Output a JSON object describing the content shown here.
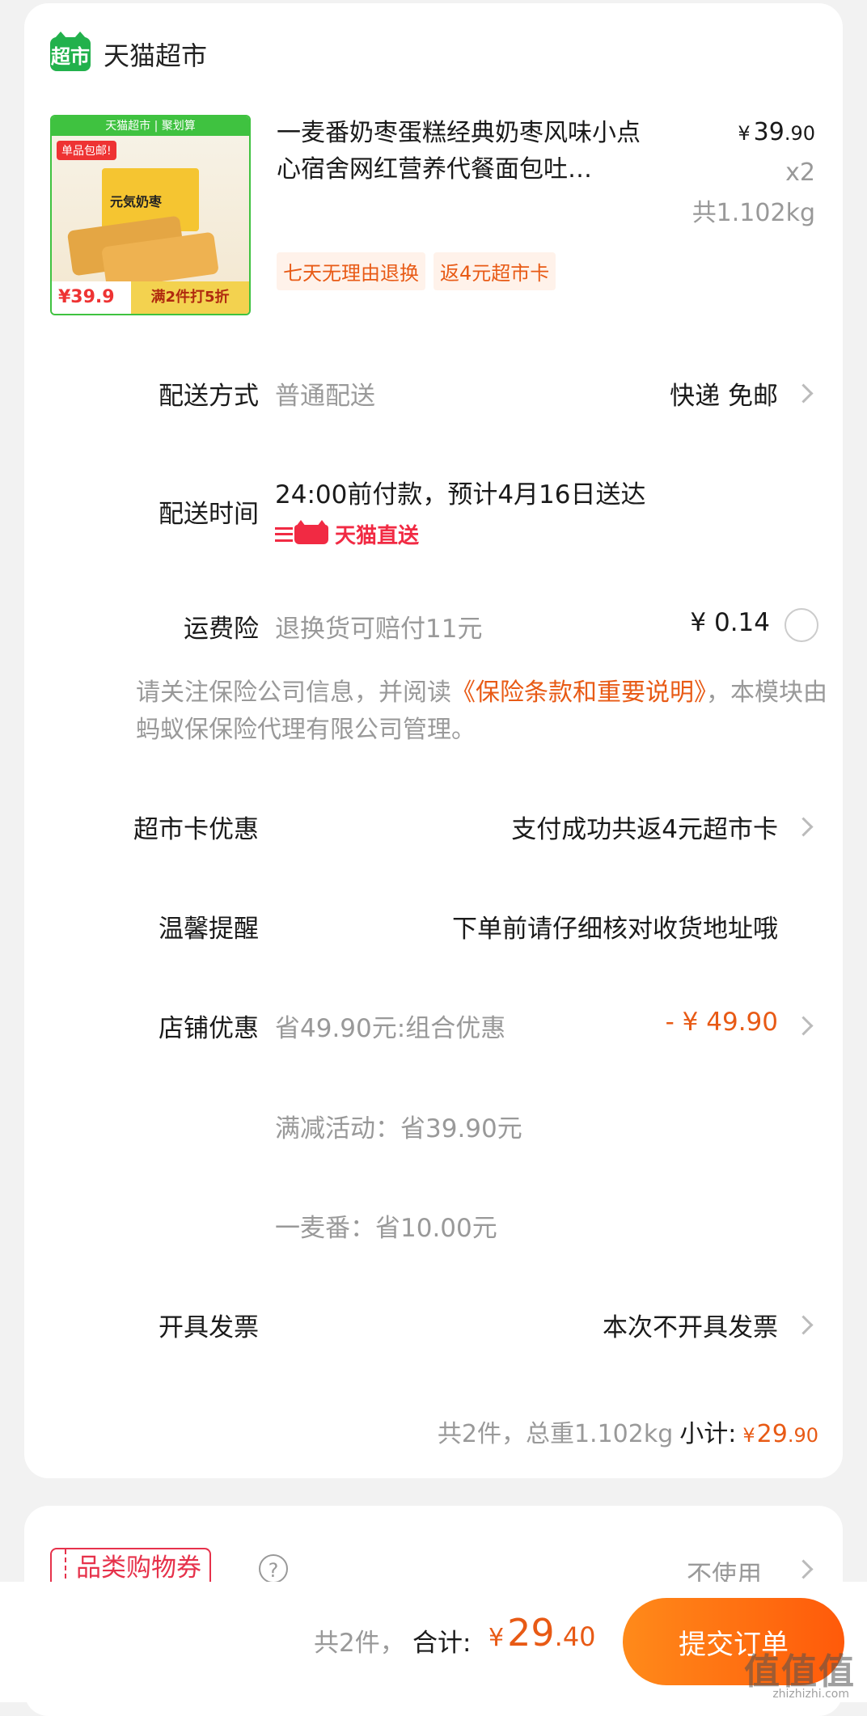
{
  "shop": {
    "logo_text": "超市",
    "name": "天猫超市"
  },
  "product": {
    "image": {
      "top_banner": "天猫超市 | 聚划算",
      "badge": "单品包邮!",
      "box_label": "元気奶枣",
      "price_tag": "¥39.9",
      "promo": "满2件打5折"
    },
    "title": "一麦番奶枣蛋糕经典奶枣风味小点心宿舍网红营养代餐面包吐…",
    "price_symbol": "¥",
    "price_int": "39",
    "price_dec": ".90",
    "quantity": "x2",
    "weight": "共1.102kg",
    "tags": [
      "七天无理由退换",
      "返4元超市卡"
    ]
  },
  "delivery": {
    "method_label": "配送方式",
    "method_value": "普通配送",
    "method_right": "快递 免邮",
    "time_label": "配送时间",
    "time_value": "24:00前付款，预计4月16日送达",
    "tmall_direct": "天猫直送"
  },
  "insurance": {
    "label": "运费险",
    "value": "退换货可赔付11元",
    "price": "¥ 0.14",
    "note_prefix": "请关注保险公司信息，并阅读",
    "note_link": "《保险条款和重要说明》",
    "note_suffix": "，本模块由蚂蚁保保险代理有限公司管理。"
  },
  "supermarket_card": {
    "label": "超市卡优惠",
    "value": "支付成功共返4元超市卡"
  },
  "reminder": {
    "label": "温馨提醒",
    "value": "下单前请仔细核对收货地址哦"
  },
  "store_discount": {
    "label": "店铺优惠",
    "value": "省49.90元:组合优惠",
    "amount": "- ¥ 49.90",
    "sub1": "满减活动：省39.90元",
    "sub2": "一麦番：省10.00元"
  },
  "invoice": {
    "label": "开具发票",
    "value": "本次不开具发票"
  },
  "summary": {
    "count_weight": "共2件，总重1.102kg",
    "subtotal_label": "小计:",
    "price_symbol": "¥",
    "price_int": "29",
    "price_dec": ".90"
  },
  "coupon": {
    "badge": "品类购物券",
    "help": "?",
    "value": "不使用"
  },
  "bottom_bar": {
    "count": "共2件，",
    "total_label": "合计:",
    "total_symbol": "¥",
    "total_int": "29",
    "total_dec": ".40",
    "submit": "提交订单"
  },
  "watermark": {
    "main": "值值值",
    "sub": "zhizhizhi.com"
  },
  "colors": {
    "accent": "#e85a15",
    "tmall_red": "#f12a43",
    "green": "#22b14c"
  }
}
